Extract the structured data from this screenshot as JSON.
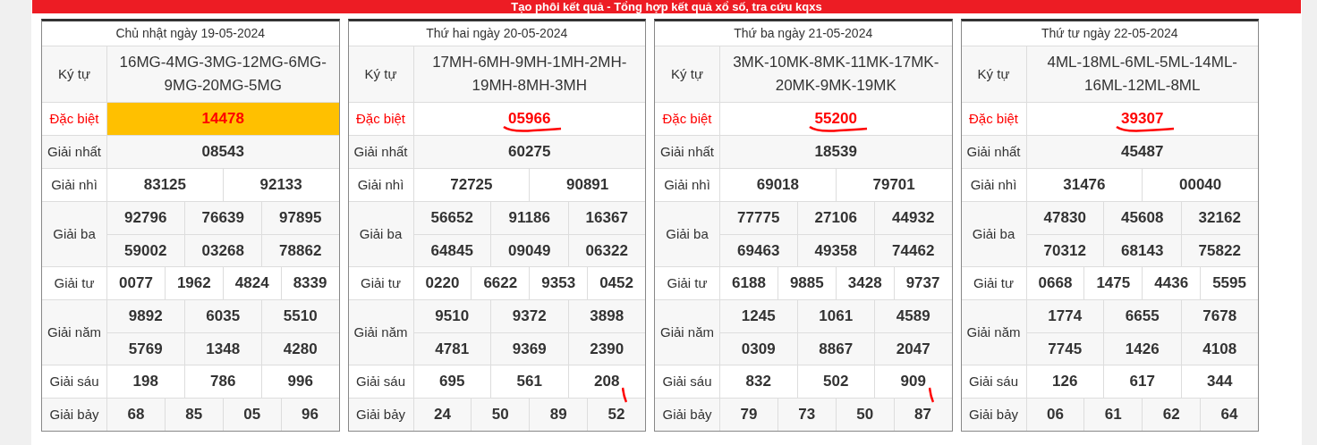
{
  "banner": {
    "title": "Tạo phôi kết quả - Tổng hợp kết quả xổ số, tra cứu kqxs"
  },
  "days": [
    {
      "title": "Chủ nhật ngày 19-05-2024",
      "code_label": "Ký tự",
      "codes": "16MG-4MG-3MG-12MG-6MG-9MG-20MG-5MG",
      "special_highlighted": true,
      "special_scribble": false,
      "sau_scribble": false,
      "prizes": [
        {
          "kind": "special",
          "label": "Đặc biệt",
          "lines": [
            [
              "14478"
            ]
          ]
        },
        {
          "kind": "normal",
          "label": "Giải nhất",
          "lines": [
            [
              "08543"
            ]
          ]
        },
        {
          "kind": "normal",
          "label": "Giải nhì",
          "lines": [
            [
              "83125",
              "92133"
            ]
          ]
        },
        {
          "kind": "normal",
          "label": "Giải ba",
          "lines": [
            [
              "92796",
              "76639",
              "97895"
            ],
            [
              "59002",
              "03268",
              "78862"
            ]
          ]
        },
        {
          "kind": "normal",
          "label": "Giải tư",
          "lines": [
            [
              "0077",
              "1962",
              "4824",
              "8339"
            ]
          ]
        },
        {
          "kind": "normal",
          "label": "Giải năm",
          "lines": [
            [
              "9892",
              "6035",
              "5510"
            ],
            [
              "5769",
              "1348",
              "4280"
            ]
          ]
        },
        {
          "kind": "normal",
          "label": "Giải sáu",
          "lines": [
            [
              "198",
              "786",
              "996"
            ]
          ]
        },
        {
          "kind": "normal",
          "label": "Giải bảy",
          "lines": [
            [
              "68",
              "85",
              "05",
              "96"
            ]
          ]
        }
      ]
    },
    {
      "title": "Thứ hai ngày 20-05-2024",
      "code_label": "Ký tự",
      "codes": "17MH-6MH-9MH-1MH-2MH-19MH-8MH-3MH",
      "special_highlighted": false,
      "special_scribble": true,
      "sau_scribble": true,
      "prizes": [
        {
          "kind": "special",
          "label": "Đặc biệt",
          "lines": [
            [
              "05966"
            ]
          ]
        },
        {
          "kind": "normal",
          "label": "Giải nhất",
          "lines": [
            [
              "60275"
            ]
          ]
        },
        {
          "kind": "normal",
          "label": "Giải nhì",
          "lines": [
            [
              "72725",
              "90891"
            ]
          ]
        },
        {
          "kind": "normal",
          "label": "Giải ba",
          "lines": [
            [
              "56652",
              "91186",
              "16367"
            ],
            [
              "64845",
              "09049",
              "06322"
            ]
          ]
        },
        {
          "kind": "normal",
          "label": "Giải tư",
          "lines": [
            [
              "0220",
              "6622",
              "9353",
              "0452"
            ]
          ]
        },
        {
          "kind": "normal",
          "label": "Giải năm",
          "lines": [
            [
              "9510",
              "9372",
              "3898"
            ],
            [
              "4781",
              "9369",
              "2390"
            ]
          ]
        },
        {
          "kind": "normal",
          "label": "Giải sáu",
          "lines": [
            [
              "695",
              "561",
              "208"
            ]
          ]
        },
        {
          "kind": "normal",
          "label": "Giải bảy",
          "lines": [
            [
              "24",
              "50",
              "89",
              "52"
            ]
          ]
        }
      ]
    },
    {
      "title": "Thứ ba ngày 21-05-2024",
      "code_label": "Ký tự",
      "codes": "3MK-10MK-8MK-11MK-17MK-20MK-9MK-19MK",
      "special_highlighted": false,
      "special_scribble": true,
      "sau_scribble": true,
      "prizes": [
        {
          "kind": "special",
          "label": "Đặc biệt",
          "lines": [
            [
              "55200"
            ]
          ]
        },
        {
          "kind": "normal",
          "label": "Giải nhất",
          "lines": [
            [
              "18539"
            ]
          ]
        },
        {
          "kind": "normal",
          "label": "Giải nhì",
          "lines": [
            [
              "69018",
              "79701"
            ]
          ]
        },
        {
          "kind": "normal",
          "label": "Giải ba",
          "lines": [
            [
              "77775",
              "27106",
              "44932"
            ],
            [
              "69463",
              "49358",
              "74462"
            ]
          ]
        },
        {
          "kind": "normal",
          "label": "Giải tư",
          "lines": [
            [
              "6188",
              "9885",
              "3428",
              "9737"
            ]
          ]
        },
        {
          "kind": "normal",
          "label": "Giải năm",
          "lines": [
            [
              "1245",
              "1061",
              "4589"
            ],
            [
              "0309",
              "8867",
              "2047"
            ]
          ]
        },
        {
          "kind": "normal",
          "label": "Giải sáu",
          "lines": [
            [
              "832",
              "502",
              "909"
            ]
          ]
        },
        {
          "kind": "normal",
          "label": "Giải bảy",
          "lines": [
            [
              "79",
              "73",
              "50",
              "87"
            ]
          ]
        }
      ]
    },
    {
      "title": "Thứ tư ngày 22-05-2024",
      "code_label": "Ký tự",
      "codes": "4ML-18ML-6ML-5ML-14ML-16ML-12ML-8ML",
      "special_highlighted": false,
      "special_scribble": true,
      "sau_scribble": false,
      "prizes": [
        {
          "kind": "special",
          "label": "Đặc biệt",
          "lines": [
            [
              "39307"
            ]
          ]
        },
        {
          "kind": "normal",
          "label": "Giải nhất",
          "lines": [
            [
              "45487"
            ]
          ]
        },
        {
          "kind": "normal",
          "label": "Giải nhì",
          "lines": [
            [
              "31476",
              "00040"
            ]
          ]
        },
        {
          "kind": "normal",
          "label": "Giải ba",
          "lines": [
            [
              "47830",
              "45608",
              "32162"
            ],
            [
              "70312",
              "68143",
              "75822"
            ]
          ]
        },
        {
          "kind": "normal",
          "label": "Giải tư",
          "lines": [
            [
              "0668",
              "1475",
              "4436",
              "5595"
            ]
          ]
        },
        {
          "kind": "normal",
          "label": "Giải năm",
          "lines": [
            [
              "1774",
              "6655",
              "7678"
            ],
            [
              "7745",
              "1426",
              "4108"
            ]
          ]
        },
        {
          "kind": "normal",
          "label": "Giải sáu",
          "lines": [
            [
              "126",
              "617",
              "344"
            ]
          ]
        },
        {
          "kind": "normal",
          "label": "Giải bảy",
          "lines": [
            [
              "06",
              "61",
              "62",
              "64"
            ]
          ]
        }
      ]
    }
  ]
}
